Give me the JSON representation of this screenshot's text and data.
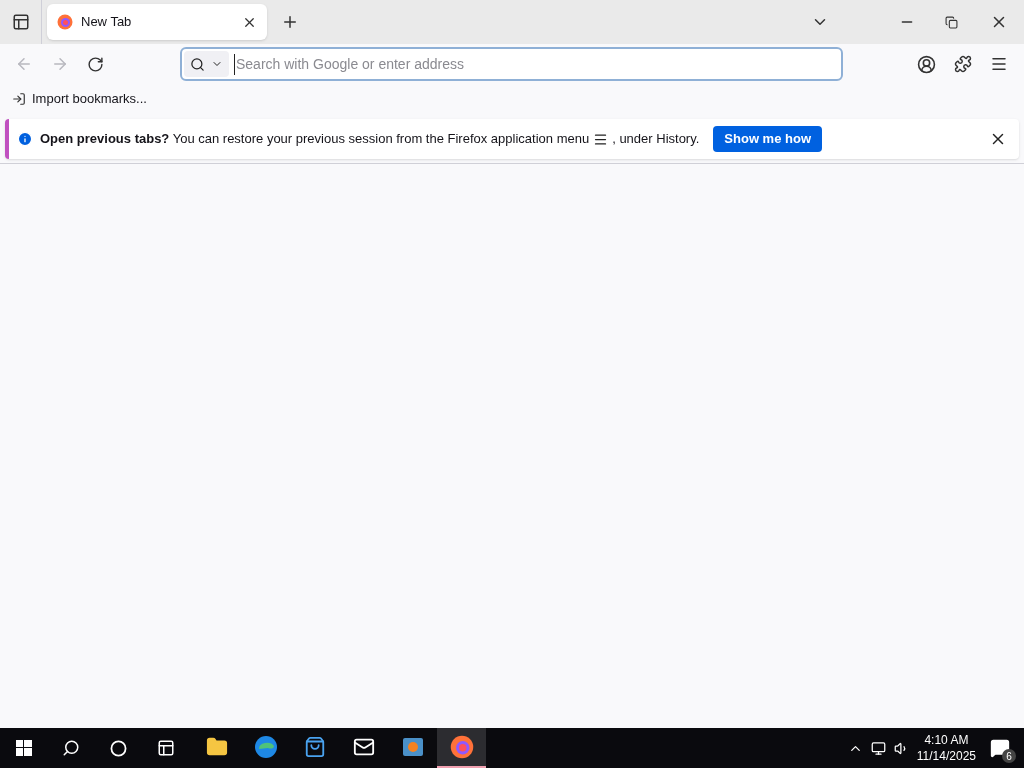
{
  "tabs": [
    {
      "label": "New Tab",
      "selected": true
    }
  ],
  "address_bar": {
    "placeholder": "Search with Google or enter address"
  },
  "bookmarks": [
    {
      "label": "Import bookmarks..."
    }
  ],
  "notification": {
    "text": "**Open previous tabs?** You can restore your previous session from the Firefox application menu",
    "text_after": ", under History.",
    "button": "Show me how"
  },
  "taskbar": {
    "apps": [
      {
        "kind": "files",
        "selected": false
      },
      {
        "kind": "edge",
        "selected": false
      },
      {
        "kind": "store",
        "selected": false
      },
      {
        "kind": "mail",
        "selected": false
      },
      {
        "kind": "media",
        "selected": false
      },
      {
        "kind": "firefox",
        "selected": true
      }
    ],
    "time": "4:10 AM",
    "date": "11/14/2025",
    "notification_count": "6"
  }
}
